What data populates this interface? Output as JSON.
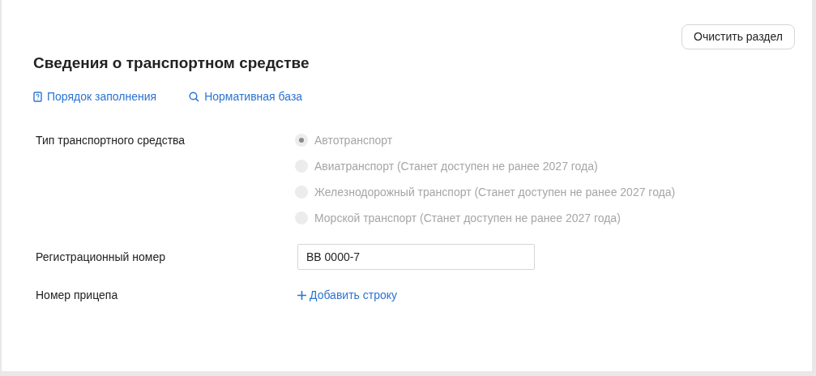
{
  "clear_button": "Очистить раздел",
  "title": "Сведения о транспортном средстве",
  "links": [
    {
      "kind": "help",
      "label": "Порядок заполнения"
    },
    {
      "kind": "search",
      "label": "Нормативная база"
    }
  ],
  "vehicle_type": {
    "label": "Тип транспортного средства",
    "options": [
      {
        "label": "Автотранспорт",
        "selected": true,
        "disabled": true
      },
      {
        "label": "Авиатранспорт (Станет доступен не ранее 2027 года)",
        "selected": false,
        "disabled": true
      },
      {
        "label": "Железнодорожный транспорт (Станет доступен не ранее 2027 года)",
        "selected": false,
        "disabled": true
      },
      {
        "label": "Морской транспорт (Станет доступен не ранее 2027 года)",
        "selected": false,
        "disabled": true
      }
    ]
  },
  "registration_number": {
    "label": "Регистрационный номер",
    "value": "ВВ 0000-7"
  },
  "trailer_number": {
    "label": "Номер прицепа",
    "add_link": "Добавить строку"
  }
}
